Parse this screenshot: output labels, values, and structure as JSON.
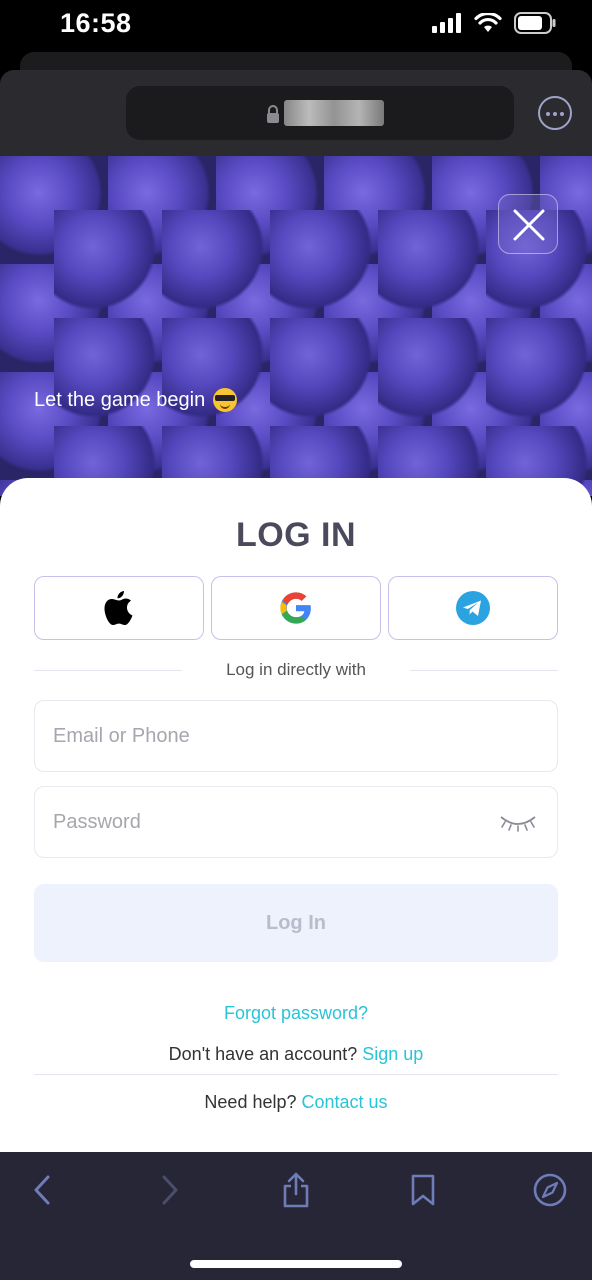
{
  "status_bar": {
    "time": "16:58",
    "icons": [
      "signal-icon",
      "wifi-icon",
      "battery-icon"
    ]
  },
  "browser": {
    "url_hidden": true,
    "icons": [
      "lock-icon",
      "more-icon"
    ]
  },
  "hero": {
    "caption": "Let the game begin",
    "emoji": "😎",
    "background": "purple-balls"
  },
  "login": {
    "title": "LOG IN",
    "social": [
      "apple-icon",
      "google-icon",
      "telegram-icon"
    ],
    "divider_text": "Log in directly with",
    "email_placeholder": "Email or Phone",
    "password_placeholder": "Password",
    "submit_label": "Log In",
    "forgot_label": "Forgot password?",
    "no_account_text": "Don't have an account?",
    "signup_label": "Sign up",
    "help_text": "Need help?",
    "contact_label": "Contact us"
  },
  "toolbar": {
    "icons": [
      "back-icon",
      "forward-icon",
      "share-icon",
      "bookmarks-icon",
      "compass-icon"
    ]
  },
  "colors": {
    "accent": "#28c4d8",
    "button_disabled_bg": "#edf2fc",
    "social_border": "#c4c2ec",
    "title": "#4a4a5c"
  }
}
